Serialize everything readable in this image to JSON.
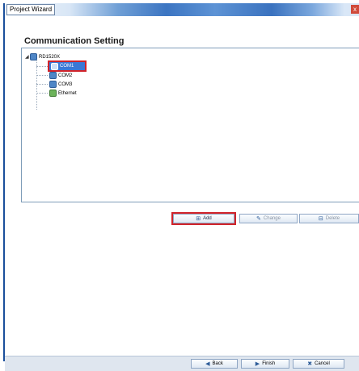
{
  "window": {
    "title": "Project Wizard",
    "close_glyph": "x"
  },
  "section_title": "Communication Setting",
  "tree": {
    "root": {
      "label": "RD1520X",
      "expander": "◢",
      "icon": "device-icon"
    },
    "children": [
      {
        "label": "COM1",
        "icon": "port-icon",
        "selected": true
      },
      {
        "label": "COM2",
        "icon": "port-icon"
      },
      {
        "label": "COM3",
        "icon": "port-icon"
      },
      {
        "label": "Ethernet",
        "icon": "network-icon"
      }
    ]
  },
  "actions": {
    "add": {
      "label": "Add",
      "icon": "add-icon",
      "glyph": "⊞"
    },
    "change": {
      "label": "Change",
      "icon": "edit-icon",
      "glyph": "✎",
      "disabled": true
    },
    "delete": {
      "label": "Delete",
      "icon": "delete-icon",
      "glyph": "⊟",
      "disabled": true
    }
  },
  "footer": {
    "back": {
      "label": "Back",
      "glyph": "◀"
    },
    "finish": {
      "label": "Finish",
      "glyph": "▶"
    },
    "cancel": {
      "label": "Cancel",
      "glyph": "✖"
    }
  },
  "colors": {
    "accent": "#3a78d6",
    "highlight": "#d1232a",
    "titlebar": "#3c75c2"
  }
}
